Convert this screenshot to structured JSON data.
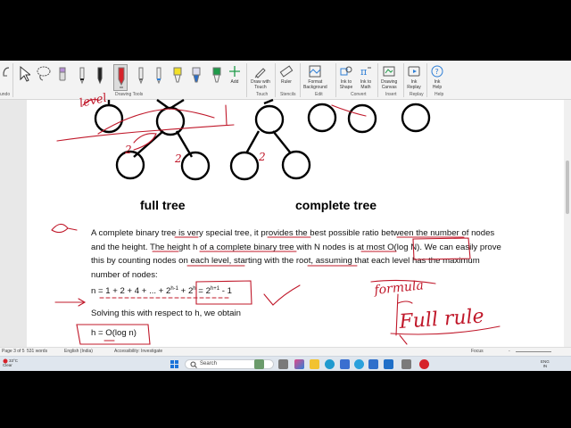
{
  "ribbon": {
    "left_label": "undo",
    "groups": {
      "drawing_tools": "Drawing Tools",
      "touch": "Touch",
      "stencils": "Stencils",
      "edit": "Edit",
      "convert": "Convert",
      "insert": "Insert",
      "replay": "Replay",
      "help": "Help"
    },
    "buttons": {
      "add": "Add",
      "draw_with_touch": "Draw with\nTouch",
      "ruler": "Ruler",
      "format_background": "Format\nBackground",
      "ink_to_shape": "Ink to\nShape",
      "ink_to_math": "Ink to\nMath",
      "drawing_canvas": "Drawing\nCanvas",
      "ink_replay": "Ink\nReplay",
      "ink_help": "Ink\nHelp"
    },
    "pen_colors": [
      "#222222",
      "#222222",
      "#d6232a",
      "#6e6e6e",
      "#2f7fd6",
      "#f2e027",
      "#1f9a49",
      "#2a6cc8"
    ]
  },
  "document": {
    "caption_full": "full tree",
    "caption_complete": "complete tree",
    "paragraph": "A complete binary tree is very special tree, it provides the best possible ratio between the number of nodes and the height. The height h of a complete binary tree with N nodes is at most O(log N). We can easily prove this by counting nodes on each level, starting with the root, assuming that each level has the maximum number of nodes:",
    "equation_main": "n = 1 + 2 + 4 + ... + 2",
    "exp_h1": "h-1",
    "equation_plus": " + 2",
    "exp_h": "h",
    "equation_eq": " = 2",
    "exp_h_plus1": "h+1",
    "equation_end": " - 1",
    "solving": "Solving this with respect to h, we obtain",
    "result": "h = O(log n)",
    "ink_words": {
      "level": "level",
      "two_a": "2",
      "two_b": "2",
      "two_c": "2",
      "formula": "formula",
      "full_rule": "Full rule"
    }
  },
  "statusbar": {
    "page": "Page 3 of 5",
    "words": "531 words",
    "language": "English (India)",
    "accessibility": "Accessibility: Investigate",
    "focus": "Focus",
    "zoom": "-"
  },
  "taskbar": {
    "weather_temp": "33°C",
    "weather_desc": "Clear",
    "search_placeholder": "Search",
    "lang": "ENG",
    "region": "IN"
  }
}
